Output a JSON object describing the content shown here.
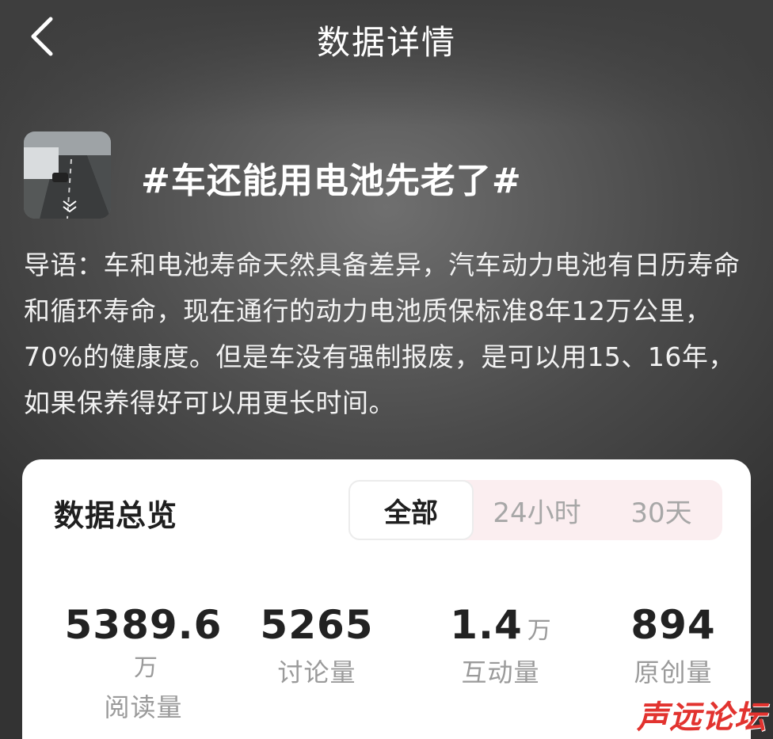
{
  "header": {
    "title": "数据详情"
  },
  "topic": {
    "title": "#车还能用电池先老了#"
  },
  "intro": {
    "text": "导语：车和电池寿命天然具备差异，汽车动力电池有日历寿命和循环寿命，现在通行的动力电池质保标准8年12万公里，70%的健康度。但是车没有强制报废，是可以用15、16年，如果保养得好可以用更长时间。"
  },
  "overview": {
    "title": "数据总览",
    "tabs": [
      {
        "label": "全部",
        "active": true
      },
      {
        "label": "24小时",
        "active": false
      },
      {
        "label": "30天",
        "active": false
      }
    ],
    "stats": [
      {
        "value": "5389.6",
        "unit": "万",
        "label": "阅读量"
      },
      {
        "value": "5265",
        "unit": "",
        "label": "讨论量"
      },
      {
        "value": "1.4",
        "unit": "万",
        "label": "互动量"
      },
      {
        "value": "894",
        "unit": "",
        "label": "原创量"
      }
    ]
  },
  "watermark": {
    "text": "声远论坛"
  },
  "colors": {
    "accent_segment_bg": "#fbeef0",
    "watermark": "#e2332f"
  }
}
